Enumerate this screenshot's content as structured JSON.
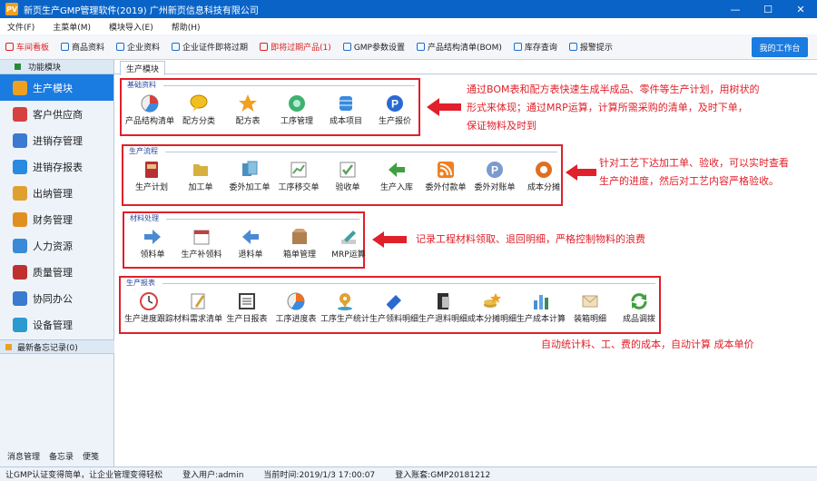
{
  "window": {
    "app_icon": "PV",
    "title": "新页生产GMP管理软件(2019) 广州新页信息科技有限公司",
    "controls": [
      "—",
      "☐",
      "✕"
    ]
  },
  "menubar": [
    "文件(F)",
    "主菜单(M)",
    "模块导入(E)",
    "帮助(H)"
  ],
  "toolbar": {
    "items": [
      {
        "label": "车间看板",
        "red": true
      },
      {
        "label": "商品资料",
        "red": false
      },
      {
        "label": "企业资料",
        "red": false
      },
      {
        "label": "企业证件即将过期",
        "red": false
      },
      {
        "label": "即将过期产品(1)",
        "red": true
      },
      {
        "label": "GMP参数设置",
        "red": false
      },
      {
        "label": "产品结构清单(BOM)",
        "red": false
      },
      {
        "label": "库存查询",
        "red": false
      },
      {
        "label": "报警提示",
        "red": false
      }
    ],
    "workbench": "我的工作台"
  },
  "sidebar": {
    "header": "功能模块",
    "items": [
      {
        "label": "生产模块",
        "color": "#f0a020"
      },
      {
        "label": "客户供应商",
        "color": "#d84040"
      },
      {
        "label": "进销存管理",
        "color": "#3a7ad0"
      },
      {
        "label": "进销存报表",
        "color": "#2a8ae0"
      },
      {
        "label": "出纳管理",
        "color": "#e0a030"
      },
      {
        "label": "财务管理",
        "color": "#e09020"
      },
      {
        "label": "人力资源",
        "color": "#3a8ad8"
      },
      {
        "label": "质量管理",
        "color": "#c03030"
      },
      {
        "label": "协同办公",
        "color": "#3a7ad0"
      },
      {
        "label": "设备管理",
        "color": "#2a9ad0"
      }
    ],
    "memo": "最新备忘记录(0)",
    "bottom": [
      "消息管理",
      "备忘录",
      "便笺"
    ]
  },
  "tab": "生产模块",
  "groups": [
    {
      "title": "基础资料",
      "items": [
        {
          "label": "产品结构清单",
          "icon": "pie-chart-icon",
          "color": "#d84040"
        },
        {
          "label": "配方分类",
          "icon": "chat-bubble-icon",
          "color": "#f0c020"
        },
        {
          "label": "配方表",
          "icon": "star-icon",
          "color": "#f0a020"
        },
        {
          "label": "工序管理",
          "icon": "disc-icon",
          "color": "#40b070"
        },
        {
          "label": "成本项目",
          "icon": "database-icon",
          "color": "#3a8ae0"
        },
        {
          "label": "生产报价",
          "icon": "p-coin-icon",
          "color": "#2a6ad0"
        }
      ]
    },
    {
      "title": "生产流程",
      "items": [
        {
          "label": "生产计划",
          "icon": "book-icon",
          "color": "#b83030"
        },
        {
          "label": "加工单",
          "icon": "folder-icon",
          "color": "#d8b040"
        },
        {
          "label": "委外加工单",
          "icon": "files-icon",
          "color": "#4a90c0"
        },
        {
          "label": "工序移交单",
          "icon": "chart-doc-icon",
          "color": "#60a060"
        },
        {
          "label": "验收单",
          "icon": "check-doc-icon",
          "color": "#60a060"
        },
        {
          "label": "生产入库",
          "icon": "left-arrow-icon",
          "color": "#40a040"
        },
        {
          "label": "委外付款单",
          "icon": "rss-icon",
          "color": "#f08020"
        },
        {
          "label": "委外对账单",
          "icon": "p-coin-icon",
          "color": "#7a9ad0"
        },
        {
          "label": "成本分摊",
          "icon": "donut-icon",
          "color": "#e07020"
        }
      ]
    },
    {
      "title": "材料处理",
      "items": [
        {
          "label": "领料单",
          "icon": "right-arrow-icon",
          "color": "#4a8ad0"
        },
        {
          "label": "生产补领料",
          "icon": "calendar-icon",
          "color": "#c04040"
        },
        {
          "label": "退料单",
          "icon": "left-arrow-icon",
          "color": "#4a8ad0"
        },
        {
          "label": "箱单管理",
          "icon": "box-icon",
          "color": "#b08050"
        },
        {
          "label": "MRP运算",
          "icon": "pencil-icon",
          "color": "#40a0a0"
        }
      ]
    },
    {
      "title": "生产报表",
      "items": [
        {
          "label": "生产进度跟踪",
          "icon": "clock-icon",
          "color": "#d84040"
        },
        {
          "label": "材料需求清单",
          "icon": "note-icon",
          "color": "#d0a040"
        },
        {
          "label": "生产日报表",
          "icon": "list-icon",
          "color": "#404040"
        },
        {
          "label": "工序进度表",
          "icon": "pie-chart-icon",
          "color": "#f07020"
        },
        {
          "label": "工序生产统计",
          "icon": "pin-icon",
          "color": "#e0a030"
        },
        {
          "label": "生产领料明细",
          "icon": "books-icon",
          "color": "#2a6ad0"
        },
        {
          "label": "生产退料明细",
          "icon": "binder-icon",
          "color": "#303030"
        },
        {
          "label": "成本分摊明细",
          "icon": "coins-icon",
          "color": "#d0a030"
        },
        {
          "label": "生产成本计算",
          "icon": "bar-chart-icon",
          "color": "#4a90d0"
        },
        {
          "label": "装箱明细",
          "icon": "envelope-icon",
          "color": "#c0a070"
        },
        {
          "label": "成品调拨",
          "icon": "refresh-icon",
          "color": "#40a040"
        }
      ]
    }
  ],
  "notes": [
    [
      "通过BOM表和配方表快速生成半成品、零件等生产计划，用树状的",
      "形式来体现；通过MRP运算，计算所需采购的清单，及时下单，",
      "保证物料及时到"
    ],
    [
      "针对工艺下达加工单、验收，可以实时查看",
      "生产的进度，然后对工艺内容严格验收。"
    ],
    [
      "记录工程材料领取、退回明细，严格控制物料的浪费"
    ],
    [
      "自动统计料、工、费的成本，自动计算 成本单价"
    ]
  ],
  "status": [
    "让GMP认证变得简单，让企业管理变得轻松",
    "登入用户:admin",
    "当前时间:2019/1/3 17:00:07",
    "登入账套:GMP20181212"
  ]
}
